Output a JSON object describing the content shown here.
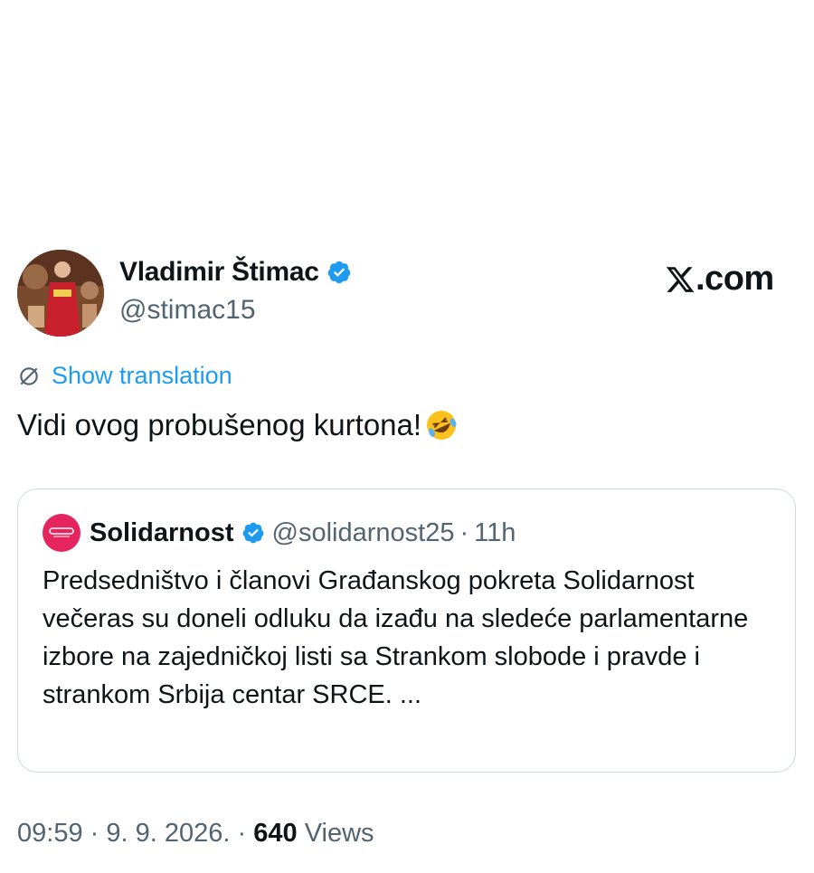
{
  "author": {
    "display_name": "Vladimir Štimac",
    "handle": "@stimac15",
    "verified": true
  },
  "brand": {
    "label": ".com"
  },
  "translation": {
    "label": "Show translation"
  },
  "tweet": {
    "text": "Vidi ovog probušenog kurtona!",
    "emoji": "rolling-on-floor-laughing"
  },
  "quoted": {
    "display_name": "Solidarnost",
    "handle": "@solidarnost25",
    "separator": "·",
    "time": "11h",
    "body": "Predsedništvo i članovi Građanskog pokreta Solidarnost večeras su doneli odluku da izađu na sledeće parlamentarne izbore na zajedničkoj listi sa Strankom slobode i pravde i strankom Srbija centar SRCE. ..."
  },
  "footer": {
    "time": "09:59",
    "sep1": "·",
    "date": "9. 9. 2026.",
    "sep2": "·",
    "views_count": "640",
    "views_label": "Views"
  },
  "colors": {
    "accent": "#1d9bf0",
    "muted": "#536471",
    "quote_avatar": "#e6255e"
  }
}
